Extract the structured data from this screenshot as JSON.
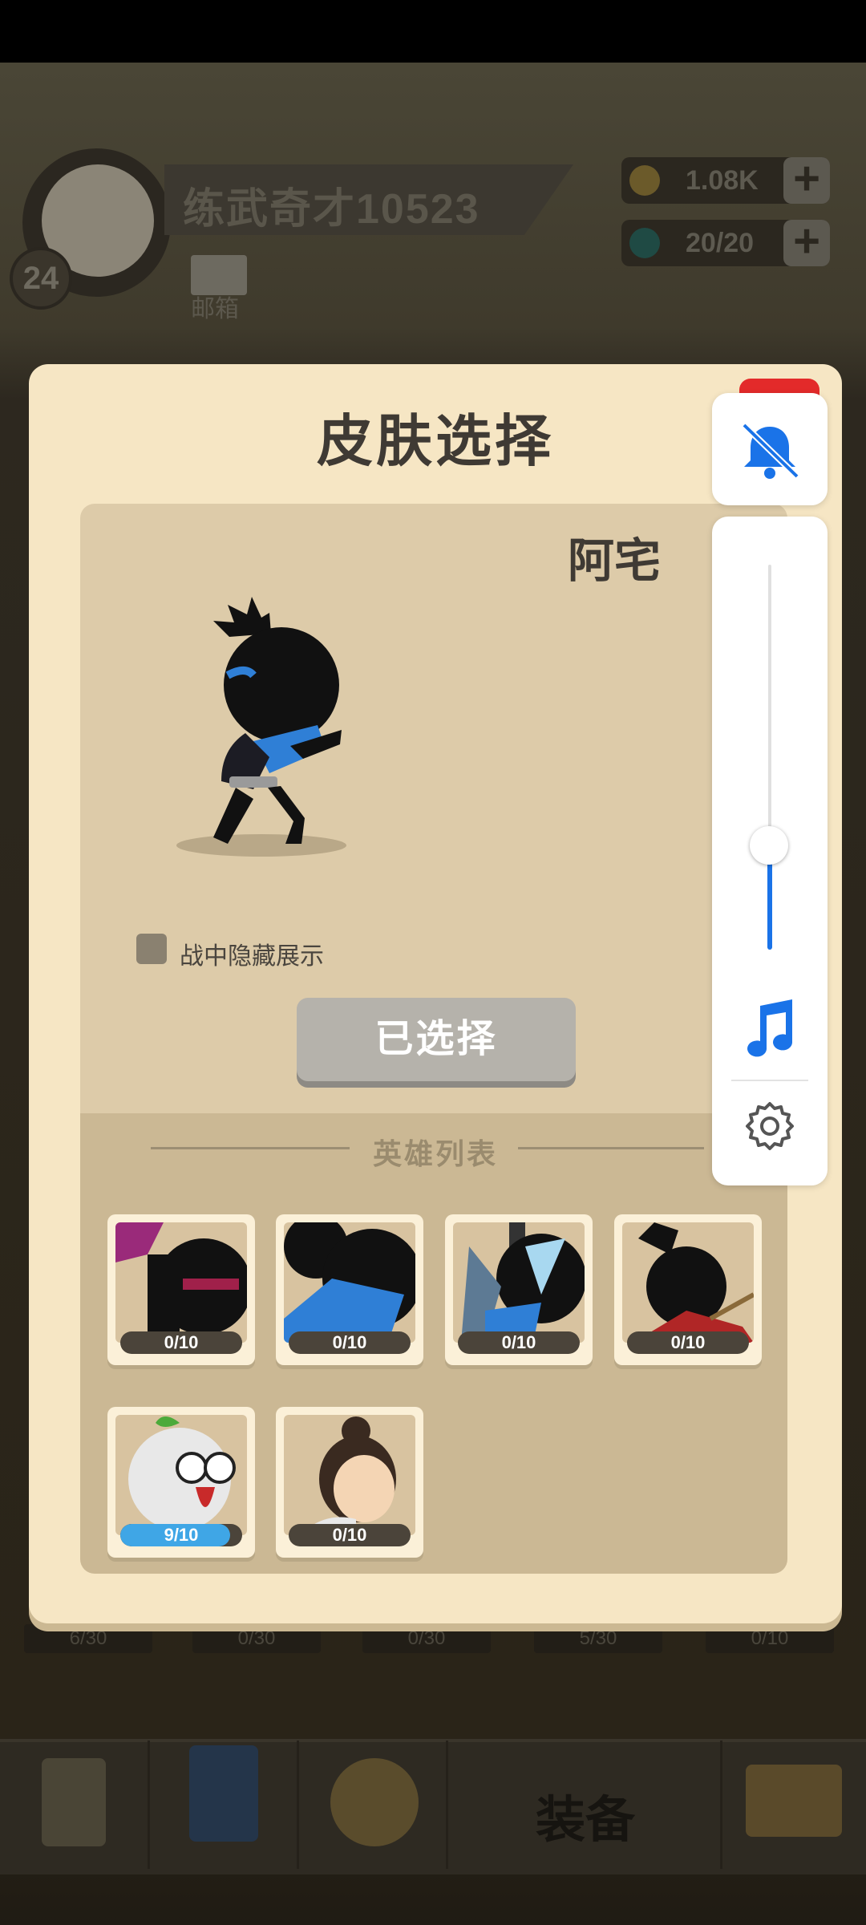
{
  "background": {
    "player": {
      "name": "练武奇才10523",
      "level": "24",
      "mail_label": "邮箱"
    },
    "resources": {
      "coins": "1.08K",
      "energy": "20/20"
    },
    "bottom_nav": {
      "equipment_label": "装备"
    },
    "slot_counts": [
      "6/30",
      "0/30",
      "0/30",
      "5/30",
      "0/10"
    ]
  },
  "modal": {
    "title": "皮肤选择",
    "selected_hero_name": "阿宅",
    "hide_in_battle_label": "战中隐藏展示",
    "selected_button_label": "已选择",
    "hero_list_title": "英雄列表",
    "heroes": [
      {
        "count": "0/10",
        "progress": 0.0
      },
      {
        "count": "0/10",
        "progress": 0.0
      },
      {
        "count": "0/10",
        "progress": 0.0
      },
      {
        "count": "0/10",
        "progress": 0.0
      },
      {
        "count": "9/10",
        "progress": 0.9
      },
      {
        "count": "0/10",
        "progress": 0.0
      }
    ]
  },
  "volume_overlay": {
    "muted": true,
    "level": 0.27,
    "icons": [
      "bell-off-icon",
      "music-note-icon",
      "gear-icon"
    ],
    "accent": "#1a73e8"
  },
  "colors": {
    "modal_bg": "#f6e6c4",
    "progress_fill": "#3fa6e6",
    "notice_red": "#e32a2a"
  }
}
